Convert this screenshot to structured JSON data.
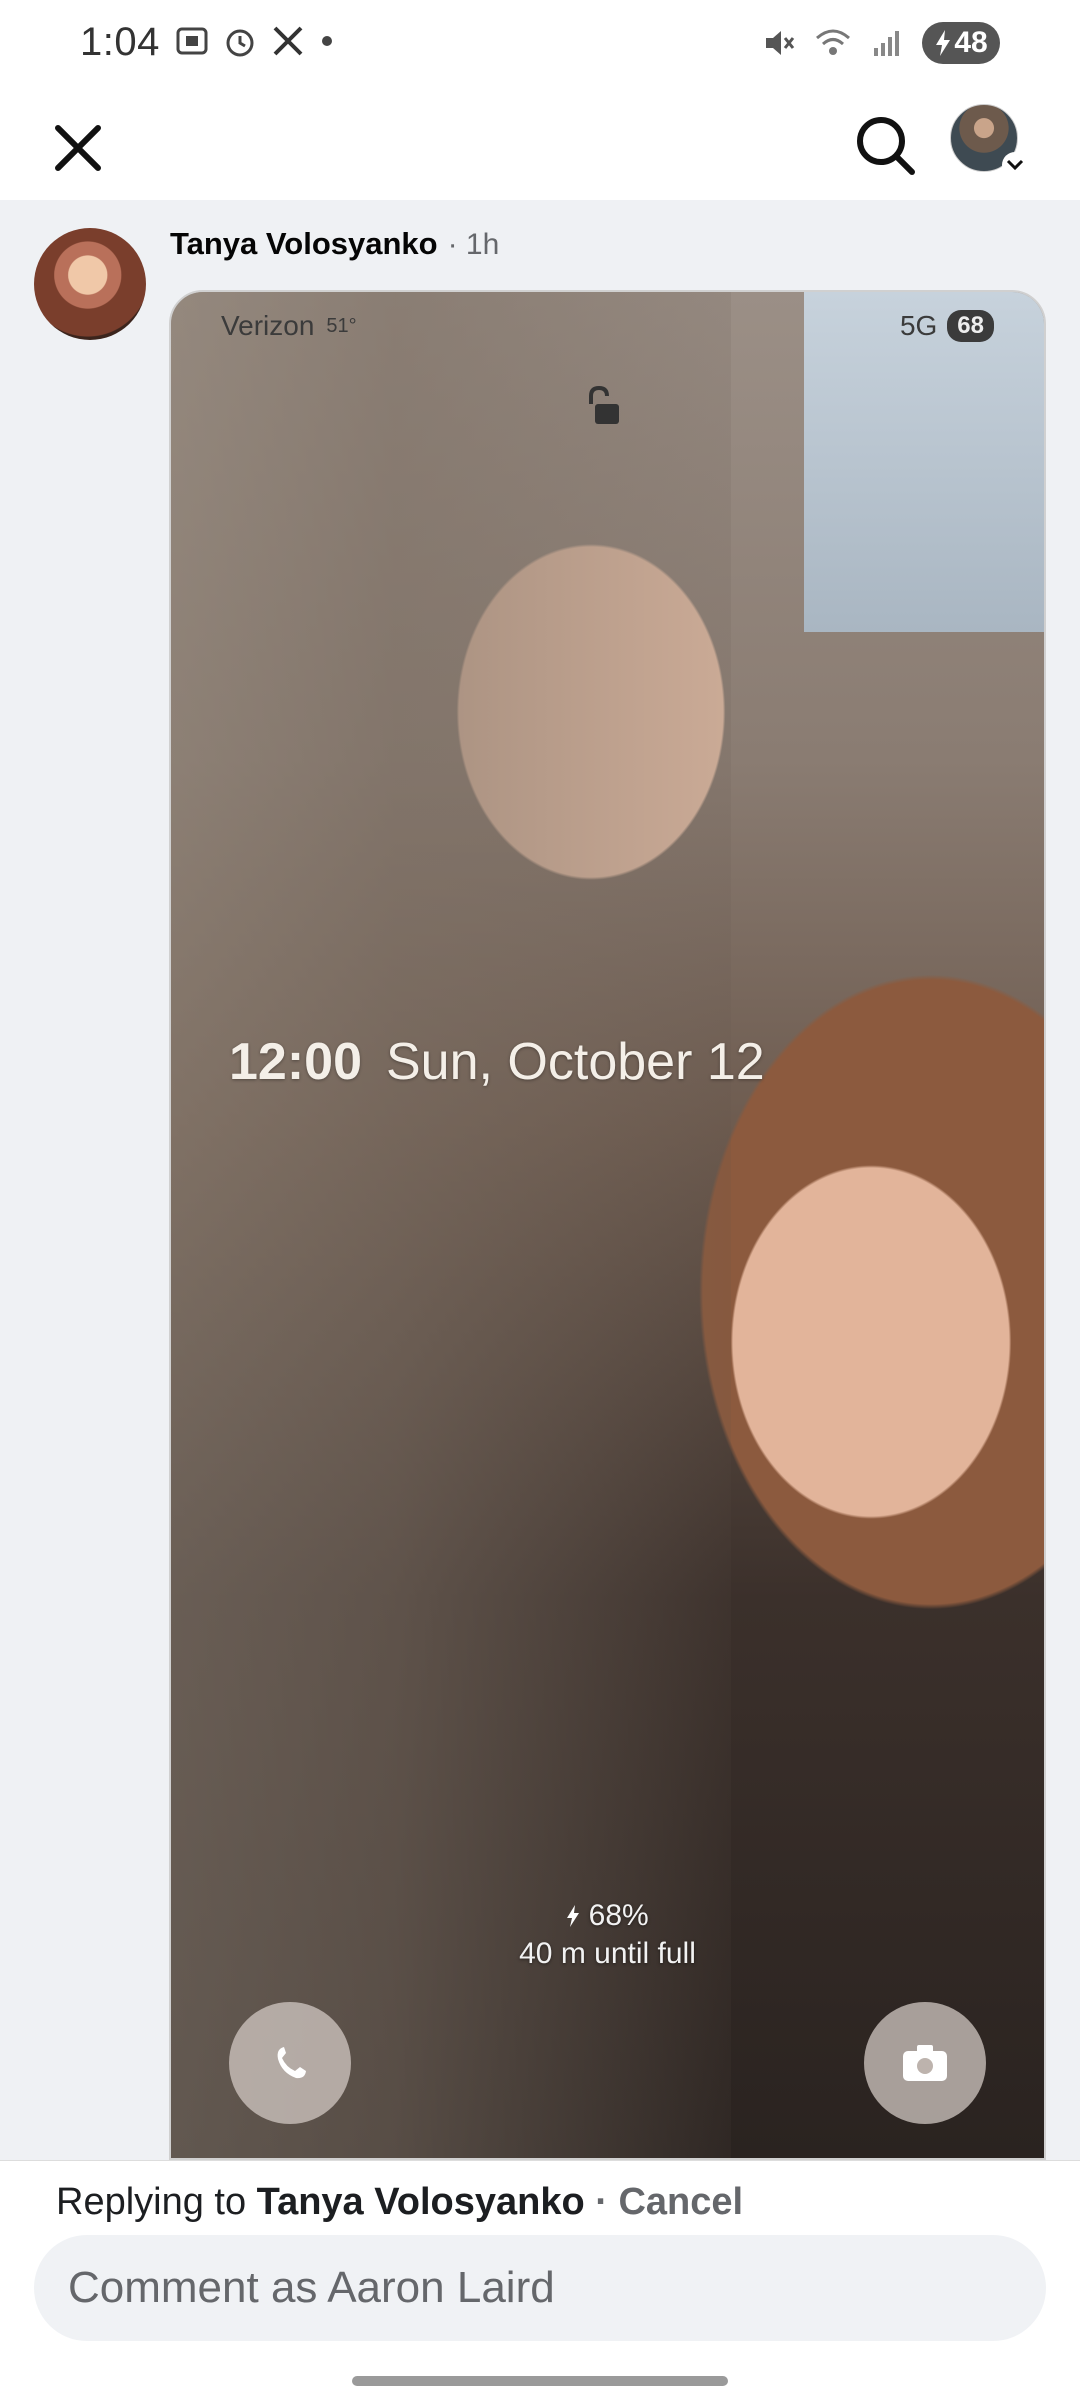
{
  "status_bar": {
    "time": "1:04",
    "battery": "48",
    "left_icons": [
      "screenshot-icon",
      "alarm-icon",
      "x-logo-icon",
      "dot-icon"
    ],
    "right_icons": [
      "mute-icon",
      "wifi-icon",
      "signal-icon",
      "battery-charging-icon"
    ]
  },
  "app_bar": {
    "icons": [
      "close-icon",
      "search-icon",
      "profile-avatar"
    ]
  },
  "comment": {
    "author": "Tanya Volosyanko",
    "time": "· 1h",
    "photo": {
      "carrier": "Verizon",
      "status_extra": "51°",
      "network": "5G",
      "battery": "68",
      "time": "12:00",
      "date": "Sun, October 12",
      "charge_percent": "68%",
      "charge_note": "40 m until full"
    }
  },
  "reply": {
    "prefix": "Replying to ",
    "name": "Tanya Volosyanko",
    "separator": " · ",
    "cancel": "Cancel",
    "placeholder": "Comment as Aaron Laird"
  }
}
